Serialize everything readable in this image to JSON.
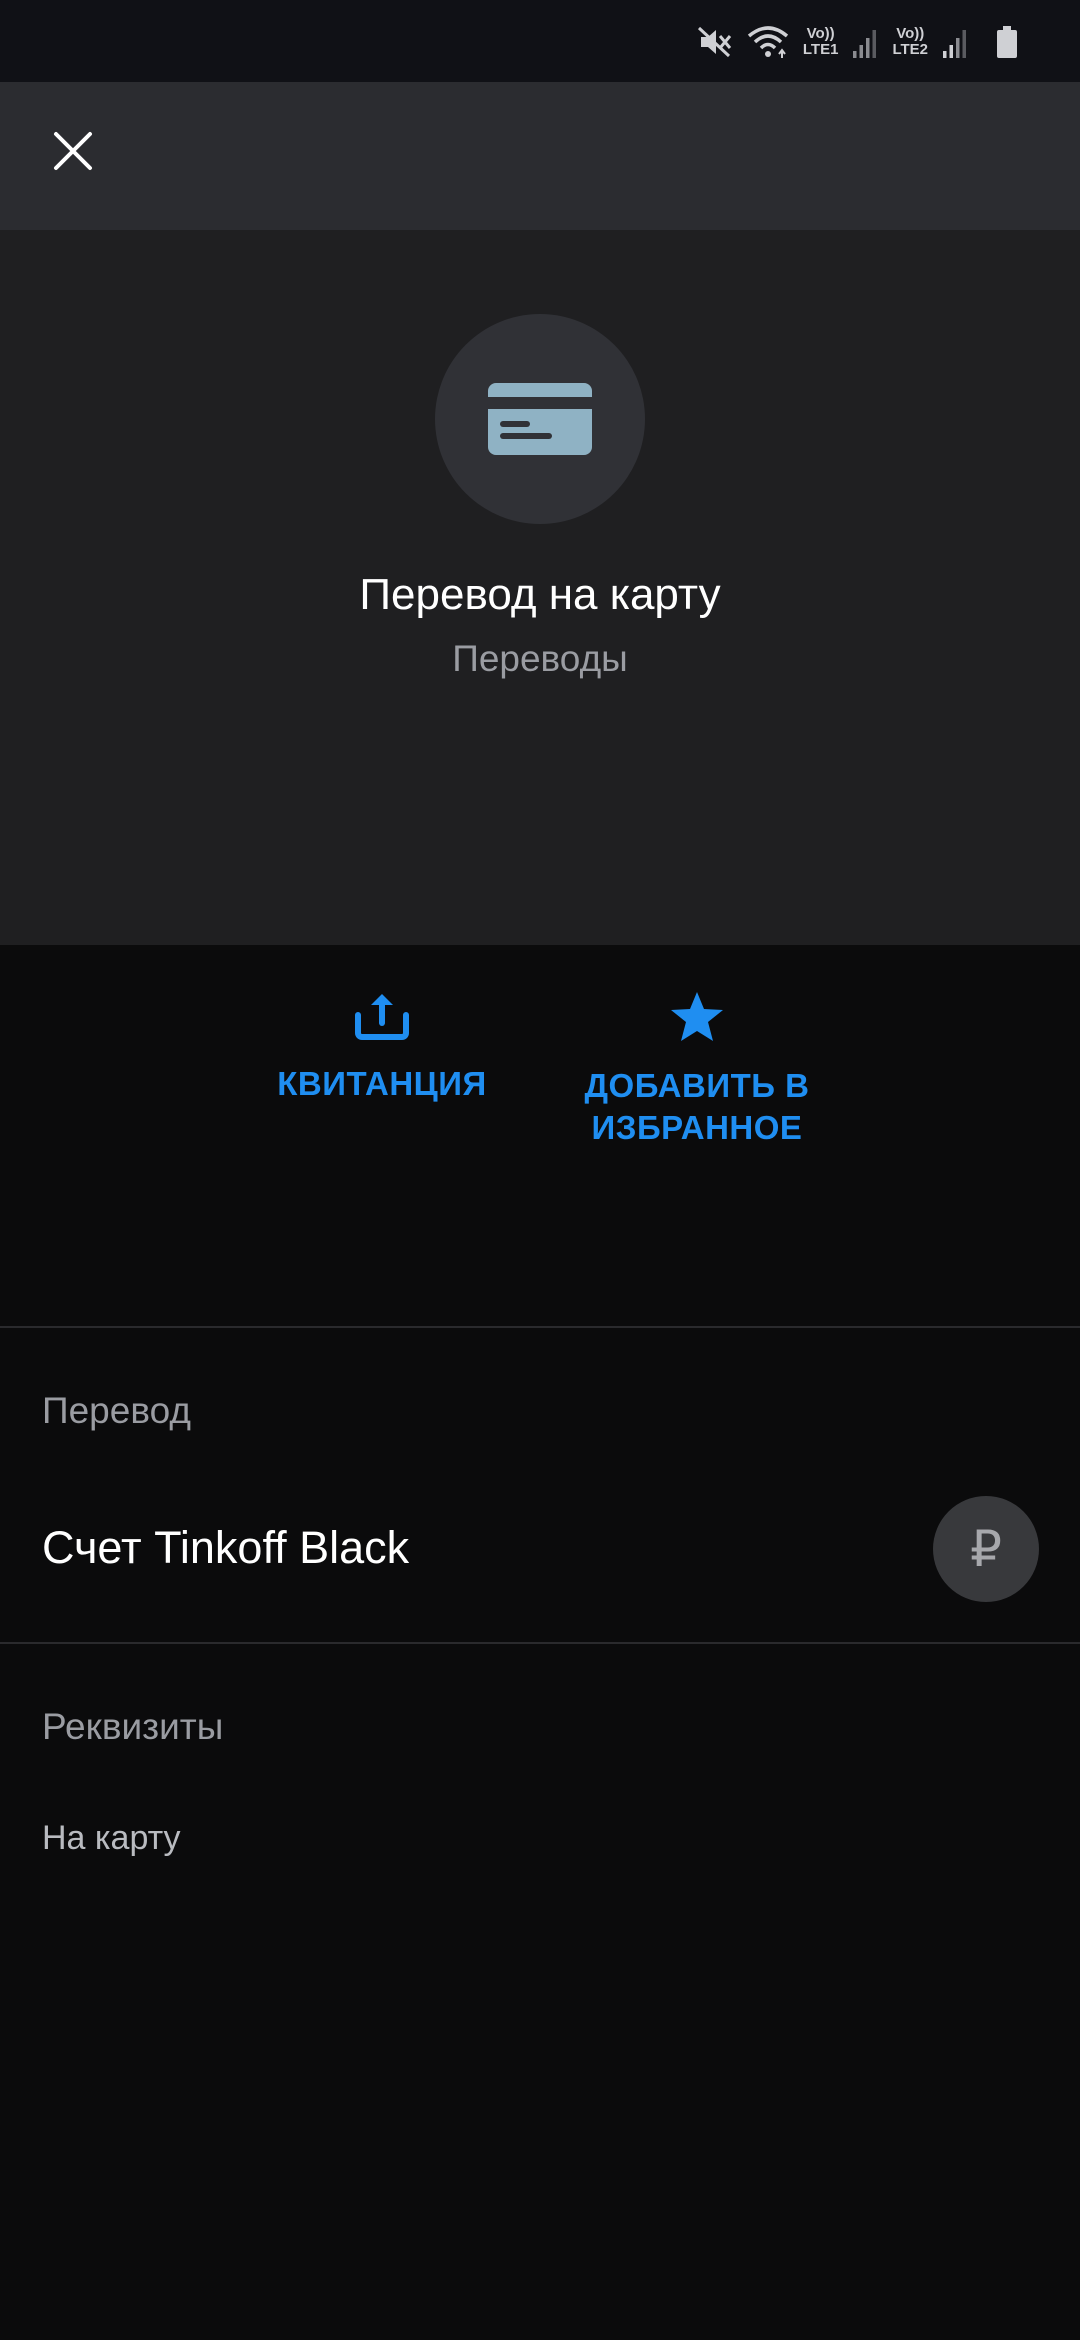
{
  "status_bar": {
    "network1_top": "Vo))",
    "network1_bottom": "LTE1",
    "network2_top": "Vo))",
    "network2_bottom": "LTE2",
    "icons": [
      "mute-icon",
      "wifi-icon",
      "signal-icon",
      "signal-icon",
      "battery-icon"
    ]
  },
  "app_bar": {
    "close_icon": "close-icon"
  },
  "operation": {
    "icon": "credit-card-icon",
    "title": "Перевод на карту",
    "subtitle": "Переводы"
  },
  "actions": {
    "receipt_label": "КВИТАНЦИЯ",
    "receipt_icon": "share-upload-icon",
    "favorite_label_line1": "ДОБАВИТЬ В",
    "favorite_label_line2": "ИЗБРАННОЕ",
    "favorite_icon": "star-icon"
  },
  "transfer_section": {
    "label": "Перевод",
    "account_name": "Счет Tinkoff Black",
    "currency_symbol": "₽"
  },
  "details_section": {
    "label": "Реквизиты",
    "value": "На карту"
  },
  "colors": {
    "accent": "#1f8ef1",
    "card_icon": "#8fb2c4",
    "background": "#0b0b0c",
    "hero_background": "#1f1f21",
    "app_bar": "#2b2c30"
  }
}
